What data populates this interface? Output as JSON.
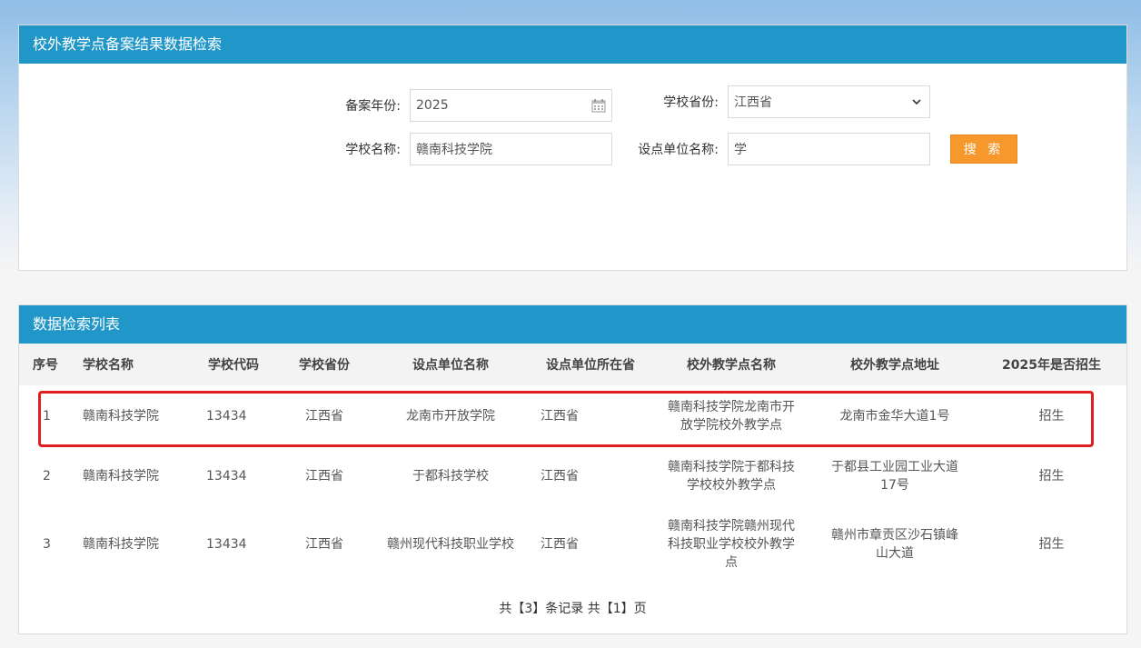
{
  "search": {
    "title": "校外教学点备案结果数据检索",
    "year_label": "备案年份:",
    "year_value": "2025",
    "province_label": "学校省份:",
    "province_value": "江西省",
    "school_label": "学校名称:",
    "school_value": "赣南科技学院",
    "unit_label": "设点单位名称:",
    "unit_value": "学",
    "search_button": "搜 索"
  },
  "results": {
    "title": "数据检索列表",
    "columns": [
      "序号",
      "学校名称",
      "学校代码",
      "学校省份",
      "设点单位名称",
      "设点单位所在省",
      "校外教学点名称",
      "校外教学点地址",
      "2025年是否招生"
    ],
    "rows": [
      {
        "index": "1",
        "school": "赣南科技学院",
        "code": "13434",
        "province": "江西省",
        "unit": "龙南市开放学院",
        "unit_province": "江西省",
        "point_name": "赣南科技学院龙南市开放学院校外教学点",
        "address": "龙南市金华大道1号",
        "enroll": "招生"
      },
      {
        "index": "2",
        "school": "赣南科技学院",
        "code": "13434",
        "province": "江西省",
        "unit": "于都科技学校",
        "unit_province": "江西省",
        "point_name": "赣南科技学院于都科技学校校外教学点",
        "address": "于都县工业园工业大道17号",
        "enroll": "招生"
      },
      {
        "index": "3",
        "school": "赣南科技学院",
        "code": "13434",
        "province": "江西省",
        "unit": "赣州现代科技职业学校",
        "unit_province": "江西省",
        "point_name": "赣南科技学院赣州现代科技职业学校校外教学点",
        "address": "赣州市章贡区沙石镇峰山大道",
        "enroll": "招生"
      }
    ],
    "pagination": "共【3】条记录 共【1】页"
  },
  "colors": {
    "header_blue": "#2196c9",
    "button_orange": "#f7982c",
    "highlight_red": "#e02020"
  }
}
